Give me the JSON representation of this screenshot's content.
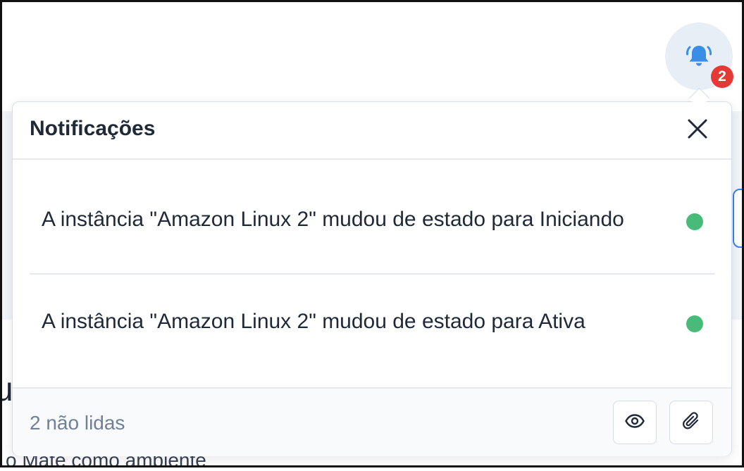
{
  "notifications": {
    "title": "Notificações",
    "badge_count": "2",
    "items": [
      {
        "text": "A instância \"Amazon Linux 2\" mudou de estado para Iniciando",
        "unread": true
      },
      {
        "text": "A instância \"Amazon Linux 2\" mudou de estado para Ativa",
        "unread": true
      }
    ],
    "unread_label": "2 não lidas",
    "icons": {
      "bell": "bell-ringing-icon",
      "close": "close-icon",
      "mark_read": "eye-icon",
      "attach": "paperclip-icon"
    }
  },
  "background": {
    "heading_fragment": "u",
    "text_fragment": "o Mate como ambiente"
  },
  "colors": {
    "accent": "#3b8ee8",
    "badge": "#e53935",
    "unread_dot": "#48bb78",
    "muted_text": "#718096"
  }
}
